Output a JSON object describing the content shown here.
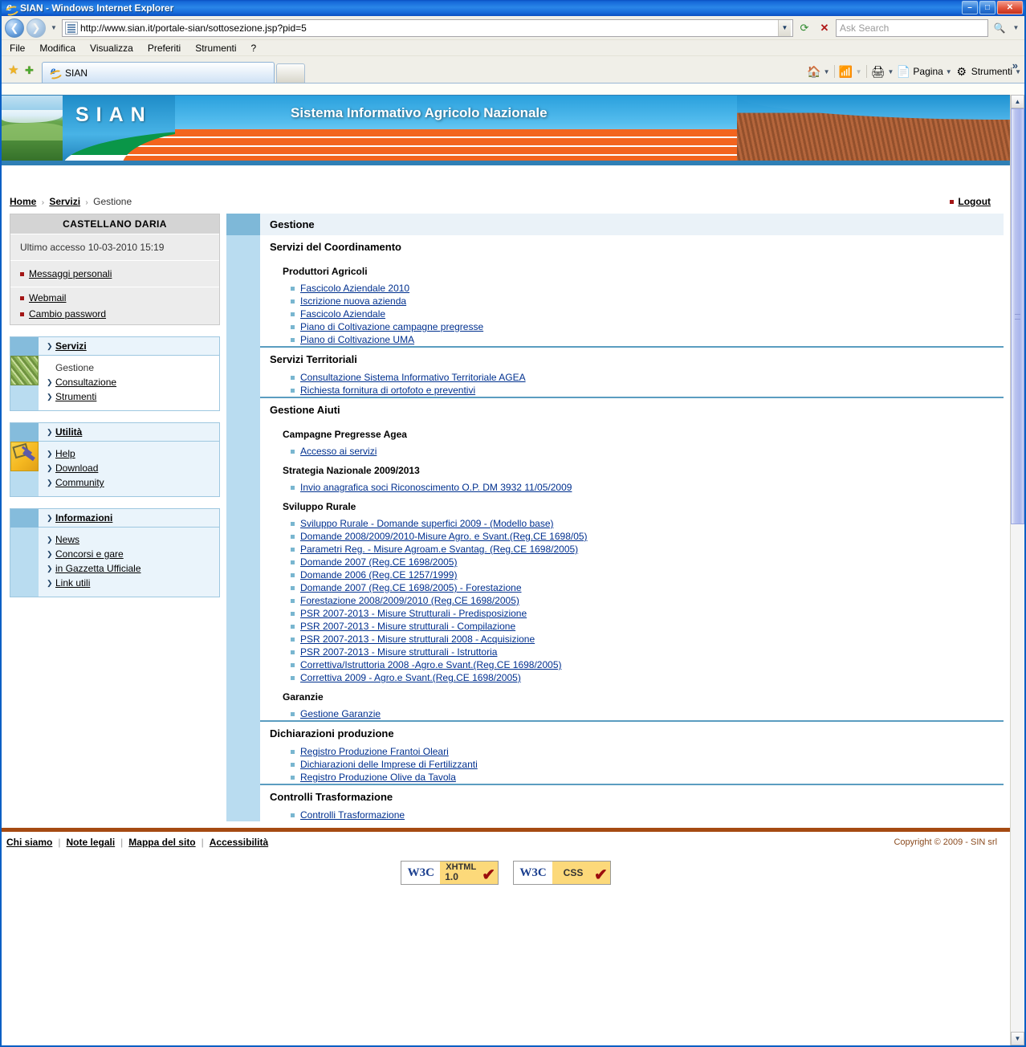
{
  "window": {
    "title": "SIAN - Windows Internet Explorer",
    "minimize": "–",
    "maximize": "□",
    "close": "✕"
  },
  "address_bar": {
    "back_icon": "back-arrow-icon",
    "forward_icon": "forward-arrow-icon",
    "url": "http://www.sian.it/portale-sian/sottosezione.jsp?pid=5",
    "refresh_icon": "refresh-icon",
    "stop_icon": "stop-icon",
    "search_placeholder": "Ask Search",
    "search_value": "",
    "go_icon": "search-icon"
  },
  "menu": {
    "items": [
      "File",
      "Modifica",
      "Visualizza",
      "Preferiti",
      "Strumenti",
      "?"
    ]
  },
  "tabs": {
    "favorites_icon": "favorites-star-icon",
    "add_favorite_icon": "add-favorite-icon",
    "items": [
      {
        "label": "SIAN"
      }
    ],
    "new_tab_label": ""
  },
  "command_bar": {
    "home_label": "",
    "feeds_label": "",
    "print_label": "",
    "page_label": "Pagina",
    "tools_label": "Strumenti",
    "overflow": "»"
  },
  "banner": {
    "logo_text": "SIAN",
    "title": "Sistema Informativo Agricolo Nazionale"
  },
  "breadcrumb": {
    "home": "Home",
    "servizi": "Servizi",
    "current": "Gestione",
    "separator": "›"
  },
  "logout": {
    "label": "Logout"
  },
  "user_box": {
    "name": "CASTELLANO DARIA",
    "last_access": "Ultimo accesso 10-03-2010 15:19",
    "links": [
      "Messaggi personali",
      "Webmail",
      "Cambio password"
    ]
  },
  "sidebar": {
    "blocks": [
      {
        "title": "Servizi",
        "icon": "farm-field-icon",
        "items": [
          {
            "label": "Gestione",
            "active": true
          },
          {
            "label": "Consultazione",
            "active": false
          },
          {
            "label": "Strumenti",
            "active": false
          }
        ]
      },
      {
        "title": "Utilità",
        "icon": "tools-icon",
        "items": [
          {
            "label": "Help",
            "active": false
          },
          {
            "label": "Download",
            "active": false
          },
          {
            "label": "Community",
            "active": false
          }
        ]
      },
      {
        "title": "Informazioni",
        "icon": "",
        "items": [
          {
            "label": "News",
            "active": false
          },
          {
            "label": "Concorsi e gare",
            "active": false
          },
          {
            "label": "in Gazzetta Ufficiale",
            "active": false
          },
          {
            "label": "Link utili",
            "active": false
          }
        ]
      }
    ]
  },
  "main": {
    "page_title": "Gestione",
    "sections": [
      {
        "title": "Servizi del Coordinamento",
        "groups": [
          {
            "heading": "Produttori Agricoli",
            "links": [
              "Fascicolo Aziendale 2010",
              "Iscrizione nuova azienda",
              "Fascicolo Aziendale",
              "Piano di Coltivazione campagne pregresse",
              "Piano di Coltivazione UMA"
            ]
          }
        ]
      },
      {
        "title": "Servizi Territoriali",
        "groups": [
          {
            "heading": "",
            "links": [
              "Consultazione Sistema Informativo Territoriale AGEA",
              "Richiesta fornitura di ortofoto e preventivi"
            ]
          }
        ]
      },
      {
        "title": "Gestione Aiuti",
        "groups": [
          {
            "heading": "Campagne Pregresse Agea",
            "links": [
              "Accesso ai servizi"
            ]
          },
          {
            "heading": "Strategia Nazionale 2009/2013",
            "links": [
              "Invio anagrafica soci Riconoscimento O.P. DM 3932 11/05/2009"
            ]
          },
          {
            "heading": "Sviluppo Rurale",
            "links": [
              "Sviluppo Rurale - Domande superfici 2009 - (Modello base)",
              "Domande 2008/2009/2010-Misure Agro. e Svant.(Reg.CE 1698/05)",
              "Parametri Reg. - Misure Agroam.e Svantag. (Reg.CE 1698/2005)",
              "Domande 2007 (Reg.CE 1698/2005)",
              "Domande 2006 (Reg.CE 1257/1999)",
              "Domande 2007 (Reg.CE 1698/2005) - Forestazione",
              "Forestazione 2008/2009/2010 (Reg.CE 1698/2005)",
              "PSR 2007-2013 - Misure Strutturali - Predisposizione",
              "PSR 2007-2013 - Misure strutturali - Compilazione",
              "PSR 2007-2013 - Misure strutturali 2008 - Acquisizione",
              "PSR 2007-2013 - Misure strutturali - Istruttoria",
              "Correttiva/Istruttoria 2008 -Agro.e Svant.(Reg.CE 1698/2005)",
              "Correttiva 2009 - Agro.e Svant.(Reg.CE 1698/2005)"
            ]
          },
          {
            "heading": "Garanzie",
            "links": [
              "Gestione Garanzie"
            ]
          }
        ]
      },
      {
        "title": "Dichiarazioni produzione",
        "groups": [
          {
            "heading": "",
            "links": [
              "Registro Produzione Frantoi Oleari",
              "Dichiarazioni delle Imprese di Fertilizzanti",
              "Registro Produzione Olive da Tavola"
            ]
          }
        ]
      },
      {
        "title": "Controlli Trasformazione",
        "groups": [
          {
            "heading": "",
            "links": [
              "Controlli Trasformazione"
            ]
          }
        ]
      }
    ]
  },
  "footer": {
    "links": [
      "Chi siamo",
      "Note legali",
      "Mappa del sito",
      "Accessibilità"
    ],
    "separator": "|",
    "copyright": "Copyright © 2009 - SIN srl",
    "badges": [
      {
        "org": "W3C",
        "kind1": "XHTML",
        "kind2": "1.0",
        "check": "✔"
      },
      {
        "org": "W3C",
        "kind1": "CSS",
        "kind2": "",
        "check": "✔"
      }
    ]
  },
  "colors": {
    "accent_blue": "#2f7fb5",
    "orange": "#f3641e",
    "green": "#0a9648",
    "link": "#00308f",
    "footer_rule": "#a54a12"
  }
}
